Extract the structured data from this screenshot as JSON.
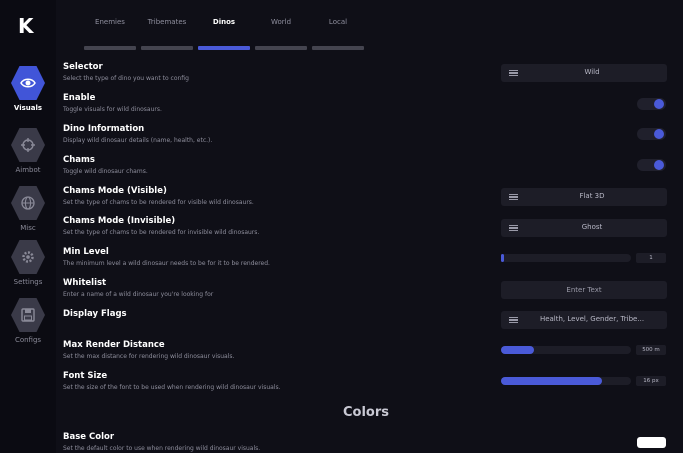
{
  "logo": "K",
  "sidebar": {
    "items": [
      {
        "label": "Visuals",
        "icon": "eye-icon",
        "active": true
      },
      {
        "label": "Aimbot",
        "icon": "crosshair-icon",
        "active": false
      },
      {
        "label": "Misc",
        "icon": "globe-icon",
        "active": false
      },
      {
        "label": "Settings",
        "icon": "gear-icon",
        "active": false
      },
      {
        "label": "Configs",
        "icon": "save-icon",
        "active": false
      }
    ]
  },
  "tabs": [
    {
      "label": "Enemies"
    },
    {
      "label": "Tribemates"
    },
    {
      "label": "Dinos",
      "active": true
    },
    {
      "label": "World"
    },
    {
      "label": "Local"
    }
  ],
  "settings": [
    {
      "title": "Selector",
      "desc": "Select the type of dino you want to config",
      "control": "dropdown",
      "value": "Wild"
    },
    {
      "title": "Enable",
      "desc": "Toggle visuals for wild dinosaurs.",
      "control": "toggle",
      "on": true
    },
    {
      "title": "Dino Information",
      "desc": "Display wild dinosaur details (name, health, etc.).",
      "control": "toggle",
      "on": true
    },
    {
      "title": "Chams",
      "desc": "Toggle wild dinosaur chams.",
      "control": "toggle",
      "on": true
    },
    {
      "title": "Chams Mode (Visible)",
      "desc": "Set the type of chams to be rendered for visible wild dinosaurs.",
      "control": "dropdown",
      "value": "Flat 3D"
    },
    {
      "title": "Chams Mode (Invisible)",
      "desc": "Set the type of chams to be rendered for invisible wild dinosaurs.",
      "control": "dropdown",
      "value": "Ghost"
    },
    {
      "title": "Min Level",
      "desc": "The minimum level a wild dinosaur needs to be for it to be rendered.",
      "control": "slider",
      "value": "1",
      "fill": 0.02
    },
    {
      "title": "Whitelist",
      "desc": "Enter a name of a wild dinosaur you're looking for",
      "control": "text",
      "placeholder": "Enter Text"
    },
    {
      "title": "Display Flags",
      "desc": "",
      "control": "dropdown",
      "value": "Health, Level, Gender, Tribe..."
    },
    {
      "title": "Max Render Distance",
      "desc": "Set the max distance for rendering wild dinosaur visuals.",
      "control": "slider",
      "value": "500 m",
      "fill": 0.25
    },
    {
      "title": "Font Size",
      "desc": "Set the size of the font to be used when rendering wild dinosaur visuals.",
      "control": "slider",
      "value": "16 px",
      "fill": 0.78
    }
  ],
  "colors_heading": "Colors",
  "base_color": {
    "title": "Base Color",
    "desc": "Set the default color to use when rendering wild dinosaur visuals.",
    "color": "#ffffff"
  },
  "accent": "#4a5ad8"
}
